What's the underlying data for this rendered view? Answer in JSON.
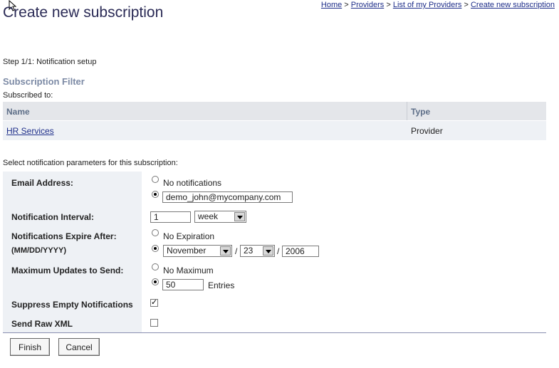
{
  "header": {
    "title": "Create new subscription"
  },
  "breadcrumb": {
    "home": "Home",
    "providers": "Providers",
    "list": "List of my Providers",
    "current": "Create new subscription",
    "sep": ">"
  },
  "step": "Step 1/1: Notification setup",
  "filter": {
    "title": "Subscription Filter",
    "subscribed_to": "Subscribed to:",
    "columns": {
      "name": "Name",
      "type": "Type"
    },
    "rows": [
      {
        "name": "HR Services",
        "type": "Provider"
      }
    ]
  },
  "params_intro": "Select notification parameters for this subscription:",
  "form": {
    "email": {
      "label": "Email Address:",
      "no_notifications": "No notifications",
      "value": "demo_john@mycompany.com",
      "selected": "address"
    },
    "interval": {
      "label": "Notification Interval:",
      "value": "1",
      "unit": "week"
    },
    "expire": {
      "label": "Notifications Expire After:",
      "format": "(MM/DD/YYYY)",
      "no_expiration": "No Expiration",
      "month": "November",
      "day": "23",
      "year": "2006",
      "sep": "/",
      "selected": "date"
    },
    "max_updates": {
      "label": "Maximum Updates to Send:",
      "no_maximum": "No Maximum",
      "value": "50",
      "unit": "Entries",
      "selected": "count"
    },
    "suppress_empty": {
      "label": "Suppress Empty Notifications",
      "checked": true
    },
    "raw_xml": {
      "label": "Send Raw XML",
      "checked": false
    }
  },
  "buttons": {
    "finish": "Finish",
    "cancel": "Cancel"
  }
}
